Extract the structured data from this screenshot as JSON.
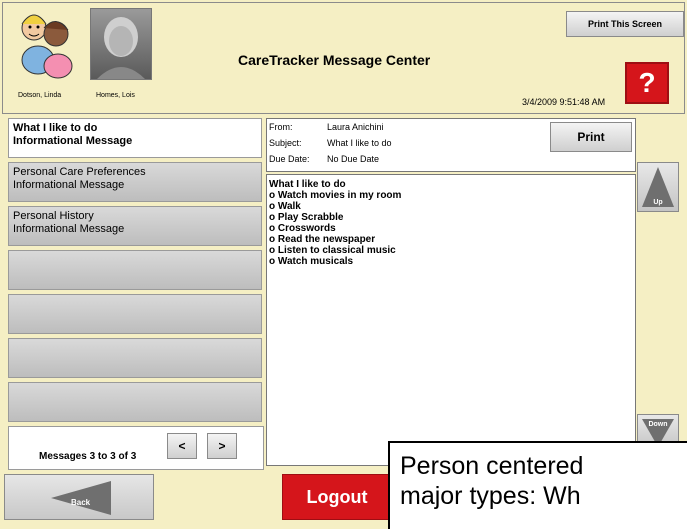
{
  "header": {
    "title": "CareTracker Message Center",
    "timestamp": "3/4/2009 9:51:48 AM",
    "print_screen_label": "Print This Screen",
    "help_label": "?",
    "avatars": [
      {
        "name": "Dotson, Linda",
        "icon": "family-cartoon-icon"
      },
      {
        "name": "Homes, Lois",
        "icon": "resident-photo"
      }
    ]
  },
  "messages": {
    "items": [
      {
        "title": "What I like to do",
        "type": "Informational Message",
        "selected": true
      },
      {
        "title": "Personal Care Preferences",
        "type": "Informational Message",
        "selected": false
      },
      {
        "title": "Personal History",
        "type": "Informational Message",
        "selected": false
      }
    ],
    "pager_text": "Messages 3 to 3 of 3",
    "prev_label": "<",
    "next_label": ">"
  },
  "detail": {
    "from_label": "From:",
    "from_value": "Laura Anichini",
    "subject_label": "Subject:",
    "subject_value": "What I like to do",
    "due_label": "Due Date:",
    "due_value": "No Due Date",
    "print_label": "Print",
    "body_lines": [
      "What I like to do",
      "o Watch movies in my room",
      "o Walk",
      "o Play Scrabble",
      "o Crosswords",
      "o Read the newspaper",
      "o Listen to classical music",
      "o Watch musicals"
    ]
  },
  "scroll": {
    "up_label": "Up",
    "down_label": "Down"
  },
  "footer": {
    "back_label": "Back",
    "logout_label": "Logout"
  },
  "overlay": {
    "line1": "Person centered",
    "line2": "major types:  Wh"
  },
  "colors": {
    "background": "#f5efc4",
    "accent_red": "#d5151b"
  }
}
